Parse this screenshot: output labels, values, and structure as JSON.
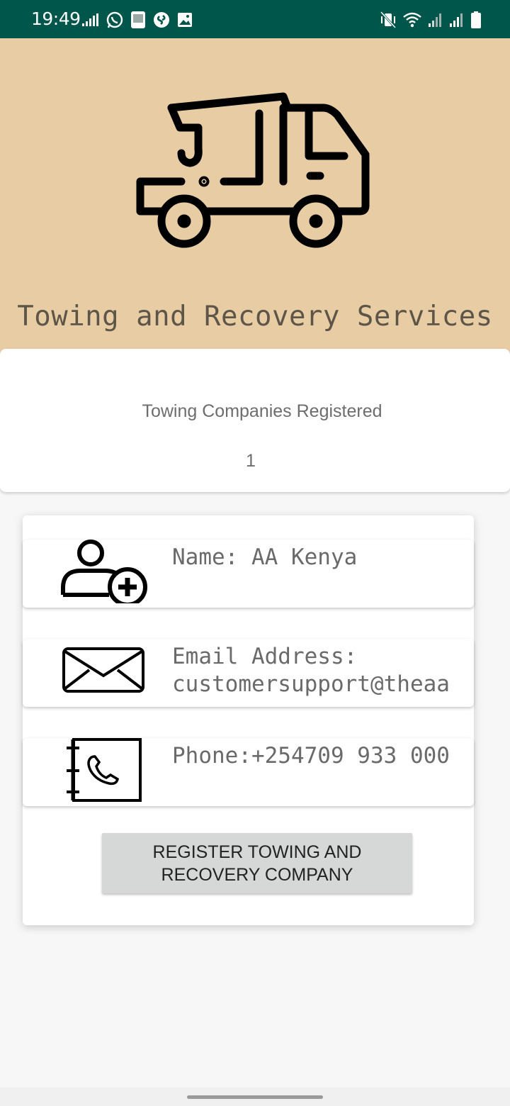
{
  "status_bar": {
    "time": "19:49",
    "left_icons": [
      "signal-bars-icon",
      "whatsapp-icon",
      "bible-app-icon",
      "shazam-icon",
      "gallery-icon"
    ],
    "right_icons": [
      "vibrate-mute-icon",
      "wifi-icon",
      "cell-signal-icon",
      "cell-signal-icon",
      "battery-icon"
    ]
  },
  "header": {
    "title": "Towing and Recovery Services",
    "background_color": "#e8cca3",
    "icon": "tow-truck-icon"
  },
  "stats": {
    "label": "Towing Companies Registered",
    "count": "1"
  },
  "company": {
    "name_text": "Name: AA Kenya",
    "email_text": "Email Address:\ncustomersupport@theaa",
    "phone_text": "Phone:+254709 933 000",
    "name_icon": "add-user-icon",
    "email_icon": "envelope-icon",
    "phone_icon": "phone-book-icon"
  },
  "actions": {
    "register_label": "REGISTER TOWING AND RECOVERY COMPANY"
  },
  "colors": {
    "status_bar": "#00564a",
    "header": "#e8cca3",
    "button": "#d6d7d7"
  }
}
